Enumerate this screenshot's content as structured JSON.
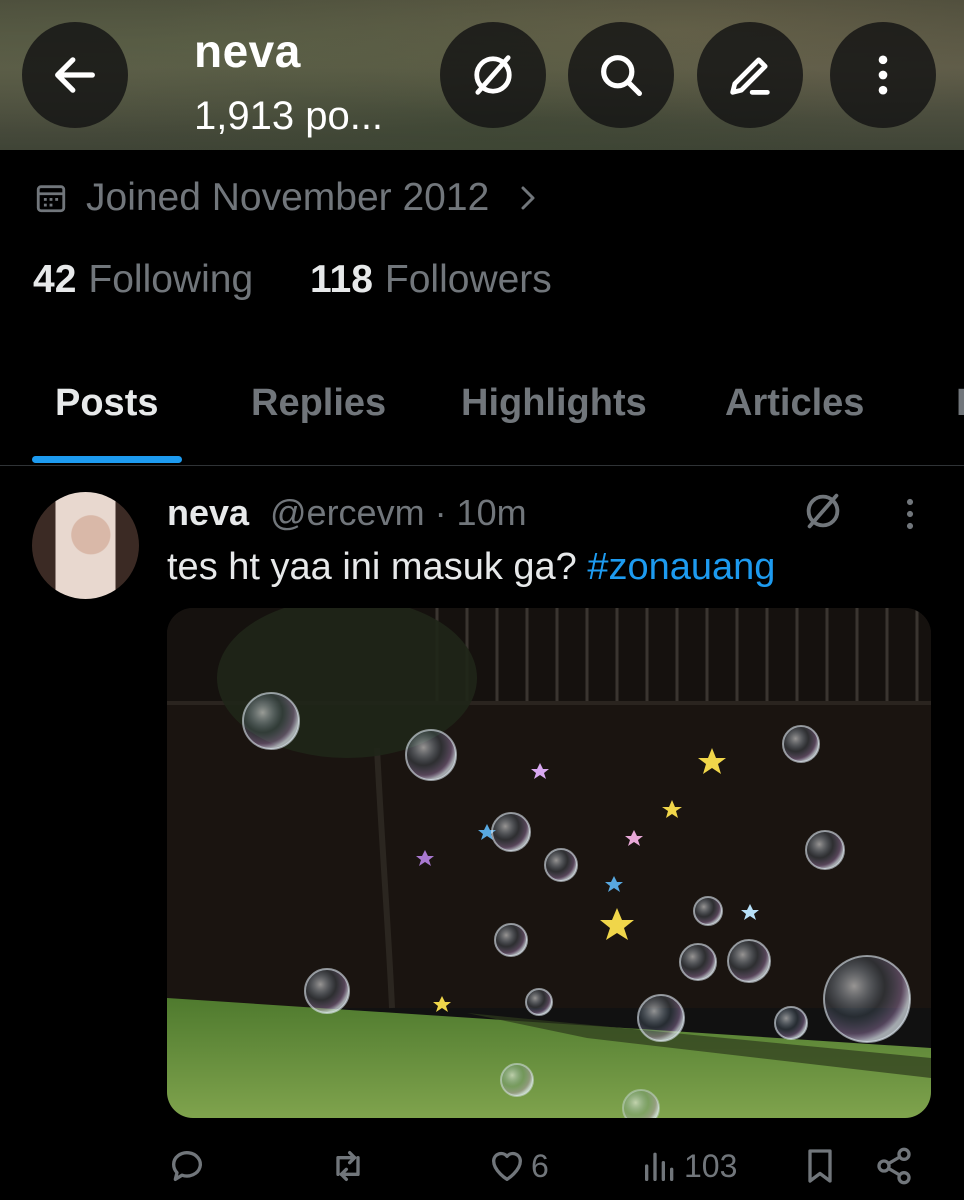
{
  "header": {
    "title": "neva",
    "post_count": "1,913 po...",
    "buttons": [
      {
        "name": "back-icon"
      },
      {
        "name": "grok-icon"
      },
      {
        "name": "search-icon"
      },
      {
        "name": "edit-icon"
      },
      {
        "name": "more-vertical-icon"
      }
    ]
  },
  "profile": {
    "joined": "Joined November 2012",
    "following_count": "42",
    "following_label": "Following",
    "followers_count": "118",
    "followers_label": "Followers"
  },
  "tabs": [
    {
      "label": "Posts",
      "active": true
    },
    {
      "label": "Replies",
      "active": false
    },
    {
      "label": "Highlights",
      "active": false
    },
    {
      "label": "Articles",
      "active": false
    }
  ],
  "post": {
    "author_name": "neva",
    "author_meta": "@ercevm · 10m",
    "text": "tes ht yaa ini masuk ga? ",
    "hashtag": "#zonauang",
    "media_description": "bubbles and stars in a backyard",
    "actions": {
      "reply_count": "",
      "repost_count": "",
      "like_count": "6",
      "views_count": "103"
    }
  },
  "colors": {
    "accent": "#1d9bf0",
    "muted": "#71767b",
    "text": "#e7e9ea",
    "background": "#000000"
  }
}
